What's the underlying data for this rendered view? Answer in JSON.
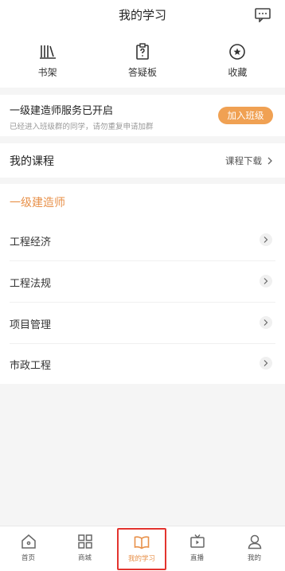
{
  "header": {
    "title": "我的学习",
    "message_icon": "message-icon"
  },
  "quick_actions": [
    {
      "label": "书架",
      "icon": "bookshelf-icon"
    },
    {
      "label": "答疑板",
      "icon": "qa-board-icon"
    },
    {
      "label": "收藏",
      "icon": "favorite-star-icon"
    }
  ],
  "notice": {
    "title": "一级建造师服务已开启",
    "subtitle": "已经进入班级群的同学，请勿重复申请加群",
    "join_label": "加入班级"
  },
  "courses": {
    "label": "我的课程",
    "download_label": "课程下载"
  },
  "course_section": {
    "title": "一级建造师",
    "items": [
      "工程经济",
      "工程法规",
      "项目管理",
      "市政工程"
    ]
  },
  "tabbar": [
    {
      "label": "首页",
      "icon": "home-icon"
    },
    {
      "label": "商城",
      "icon": "grid-icon"
    },
    {
      "label": "我的学习",
      "icon": "open-book-icon",
      "active": true
    },
    {
      "label": "直播",
      "icon": "tv-icon"
    },
    {
      "label": "我的",
      "icon": "user-icon"
    }
  ],
  "colors": {
    "accent": "#e8914a",
    "button": "#f0a153",
    "highlight_border": "#e3342f"
  }
}
